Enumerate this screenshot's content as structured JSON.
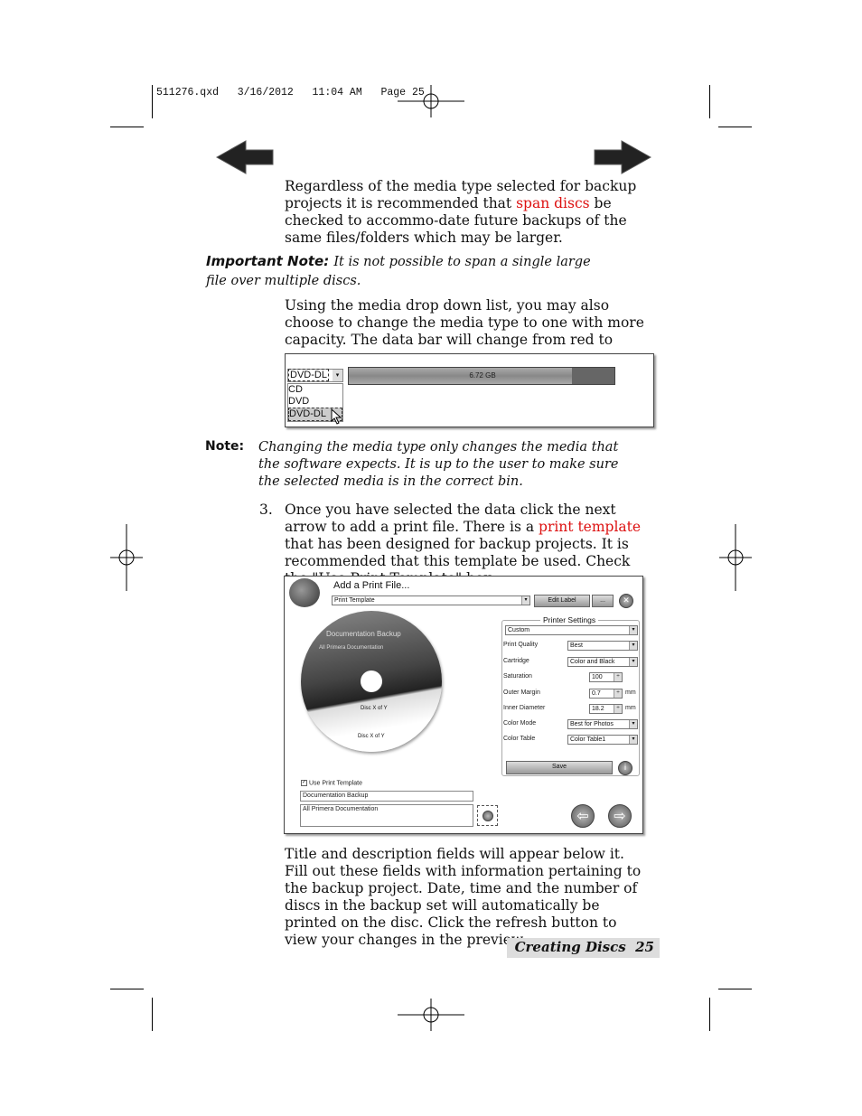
{
  "slug": "511276.qxd   3/16/2012   11:04 AM   Page 25",
  "nav": {
    "back_icon": "arrow-left-icon",
    "next_icon": "arrow-right-icon"
  },
  "para1": {
    "a": "Regardless of the media type selected for backup projects it is recommended that ",
    "link": "span discs",
    "b": " be checked to accommo-date future backups of the same files/folders which may be larger."
  },
  "important": {
    "label": "Important Note:",
    "text": "It is not possible to span a single large file over multiple discs."
  },
  "para2": "Using the media drop down list, you may also choose to change the media type to one with more capacity.  The data bar will change from red to green.",
  "media_shot": {
    "selected": "DVD-DL",
    "options": [
      "CD",
      "DVD",
      "DVD-DL"
    ],
    "bar_label": "6.72 GB",
    "bar_fill_fraction": 0.84
  },
  "note": {
    "label": "Note:",
    "text": "Changing the media type only changes the media that the software expects.  It is up to the user to make sure the selected media is in the correct bin."
  },
  "step3": {
    "num": "3.",
    "a": "Once you have selected the data click the next arrow to add a print file.  There is a ",
    "link": "print template",
    "b": " that has been designed for backup projects.  It is recommended that this template be used.  Check the \"Use Print Template\" box."
  },
  "dialog": {
    "title": "Add a Print File...",
    "template_select": "Print Template",
    "edit_label": "Edit Label",
    "browse": "...",
    "disc": {
      "title": "Documentation Backup",
      "subtitle": "All Primera Documentation",
      "disc1": "Disc X of Y",
      "disc2": "Disc X of Y"
    },
    "settings": {
      "legend": "Printer Settings",
      "preset": "Custom",
      "rows": [
        {
          "label": "Print Quality",
          "value": "Best",
          "type": "select"
        },
        {
          "label": "Cartridge",
          "value": "Color and Black",
          "type": "select"
        },
        {
          "label": "Saturation",
          "value": "100",
          "type": "spin",
          "unit": ""
        },
        {
          "label": "Outer Margin",
          "value": "0.7",
          "type": "spin",
          "unit": "mm"
        },
        {
          "label": "Inner Diameter",
          "value": "18.2",
          "type": "spin",
          "unit": "mm"
        },
        {
          "label": "Color Mode",
          "value": "Best for Photos",
          "type": "select"
        },
        {
          "label": "Color Table",
          "value": "Color Table1",
          "type": "select"
        }
      ],
      "save": "Save"
    },
    "use_template_label": "Use Print Template",
    "use_template_checked": true,
    "title_field": "Documentation Backup",
    "desc_field": "All Primera Documentation"
  },
  "para3": "Title and description fields will appear below it.  Fill out these fields with information pertaining to the backup project.  Date, time and the number of discs in the backup set will automatically be printed on the disc.  Click the refresh button to view your changes in the preview.",
  "footer": {
    "section": "Creating Discs",
    "page": "25"
  }
}
